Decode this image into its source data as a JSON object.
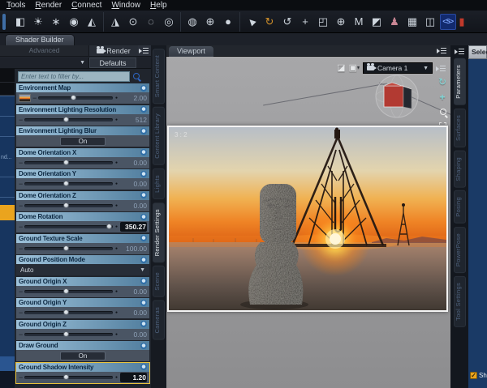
{
  "menubar": {
    "items": [
      "Tools",
      "Render",
      "Connect",
      "Window",
      "Help"
    ]
  },
  "toolbar": {
    "groups": [
      {
        "icons": [
          {
            "name": "create-camera",
            "glyph": "◧"
          },
          {
            "name": "create-distant-light",
            "glyph": "☀"
          },
          {
            "name": "create-point-light",
            "glyph": "∗"
          },
          {
            "name": "create-ambient-light",
            "glyph": "◉"
          },
          {
            "name": "create-spotlight",
            "glyph": "◭"
          }
        ]
      },
      {
        "icons": [
          {
            "name": "create-cone-light",
            "glyph": "◮"
          },
          {
            "name": "create-node",
            "glyph": "⊙"
          },
          {
            "name": "create-null",
            "glyph": "◌"
          },
          {
            "name": "create-center-point",
            "glyph": "◎"
          }
        ]
      },
      {
        "icons": [
          {
            "name": "create-group-node",
            "glyph": "◍"
          },
          {
            "name": "create-node-instance",
            "glyph": "⊕"
          },
          {
            "name": "create-primitive-sphere",
            "glyph": "●"
          }
        ]
      },
      {
        "icons": [
          {
            "name": "node-selection-tool",
            "glyph": "►",
            "cls": "rot-nw"
          },
          {
            "name": "rotate-tool",
            "glyph": "↻",
            "color": "#d4922a"
          },
          {
            "name": "twist-tool",
            "glyph": "↺"
          },
          {
            "name": "translate-tool",
            "glyph": "+"
          },
          {
            "name": "scale-tool",
            "glyph": "◰"
          },
          {
            "name": "universal-tool",
            "glyph": "⊕"
          },
          {
            "name": "mesh-grabber-tool",
            "glyph": "M"
          },
          {
            "name": "surface-selection-tool",
            "glyph": "◩"
          },
          {
            "name": "figure-setup-tool",
            "glyph": "♟",
            "color": "#c98694"
          },
          {
            "name": "spreadsheet-tool",
            "glyph": "▦"
          },
          {
            "name": "joint-editor-tool",
            "glyph": "◫"
          },
          {
            "name": "script-ide-tool",
            "glyph": "<S>",
            "cls": "script"
          },
          {
            "name": "render-tool-clipped",
            "glyph": "▮",
            "cls": "clip",
            "color": "#c0392b"
          }
        ]
      }
    ]
  },
  "shader_tab": {
    "label": "Shader Builder"
  },
  "left_panel": {
    "advanced_label": "Advanced",
    "render_label": "Render",
    "defaults_label": "Defaults",
    "filter_placeholder": "Enter text to filter by...",
    "parameters": [
      {
        "label": "Environment Map",
        "type": "slider",
        "value": "2.00",
        "pos": 47,
        "thumb": true
      },
      {
        "label": "Environment Lighting Resolution",
        "type": "slider",
        "value": "512",
        "pos": 47
      },
      {
        "label": "Environment Lighting Blur",
        "type": "toggle",
        "value": "On"
      },
      {
        "label": "Dome Orientation X",
        "type": "slider",
        "value": "0.00",
        "pos": 47
      },
      {
        "label": "Dome Orientation Y",
        "type": "slider",
        "value": "0.00",
        "pos": 47
      },
      {
        "label": "Dome Orientation Z",
        "type": "slider",
        "value": "0.00",
        "pos": 47
      },
      {
        "label": "Dome Rotation",
        "type": "slider",
        "value": "350.27",
        "pos": 95,
        "emph": true
      },
      {
        "label": "Ground Texture Scale",
        "type": "slider",
        "value": "100.00",
        "pos": 47
      },
      {
        "label": "Ground Position Mode",
        "type": "select",
        "value": "Auto"
      },
      {
        "label": "Ground Origin X",
        "type": "slider",
        "value": "0.00",
        "pos": 47
      },
      {
        "label": "Ground Origin Y",
        "type": "slider",
        "value": "0.00",
        "pos": 47
      },
      {
        "label": "Ground Origin Z",
        "type": "slider",
        "value": "0.00",
        "pos": 47
      },
      {
        "label": "Draw Ground",
        "type": "toggle",
        "value": "On"
      },
      {
        "label": "Ground Shadow Intensity",
        "type": "slider",
        "value": "1.20",
        "pos": 47,
        "emph": true,
        "selected": true
      }
    ]
  },
  "left_strip": {
    "clipped_label": "nd..."
  },
  "mid_tabs": {
    "items": [
      {
        "label": "Smart Content"
      },
      {
        "label": "Content Library"
      },
      {
        "label": "Lights"
      },
      {
        "label": "Render Settings",
        "active": true
      },
      {
        "label": "Scene"
      },
      {
        "label": "Cameras"
      }
    ]
  },
  "right_tabs": {
    "items": [
      {
        "label": "Parameters",
        "active": true
      },
      {
        "label": "Surfaces"
      },
      {
        "label": "Shaping"
      },
      {
        "label": "Posing"
      },
      {
        "label": "PowerPose"
      },
      {
        "label": "Tool Settings"
      }
    ]
  },
  "viewport": {
    "tab_label": "Viewport",
    "camera_label": "Camera 1",
    "aspect_label": "3 : 2"
  },
  "right_edge": {
    "header_label": "Selec",
    "check_label": "Sh"
  },
  "glyphs": {
    "dropdown_arrow": "▼",
    "check": "✓",
    "up_arrow": "↑",
    "orbit": "↻",
    "pan": "+",
    "aspect_icon": "◪",
    "drawstyle_icon": "▣",
    "tiny_arrow": "▾"
  },
  "colors": {
    "accent_blue_header": "#7fa6c0",
    "selection_yellow": "#e8c23c",
    "orange_highlight": "#eaa41e",
    "panel_blue": "#17355f",
    "value_emphasis": "#f2f4f6"
  }
}
